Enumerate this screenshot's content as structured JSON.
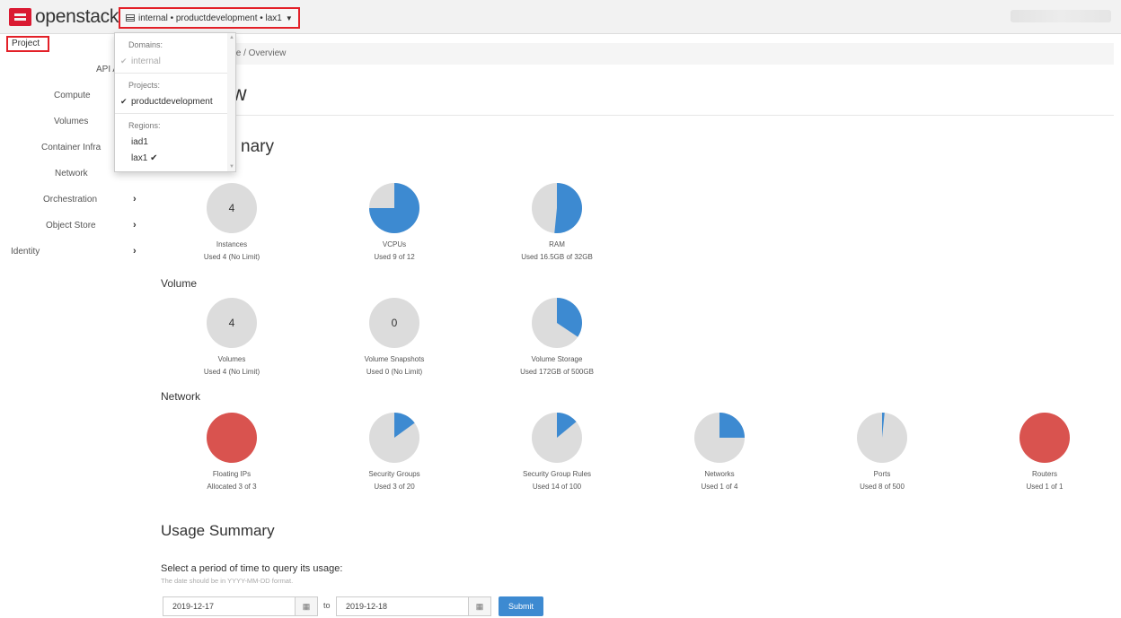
{
  "header": {
    "brand": "openstack",
    "brand_dot": ".",
    "context_label": "internal • productdevelopment • lax1"
  },
  "dropdown": {
    "domains_header": "Domains:",
    "domain_item": "internal",
    "projects_header": "Projects:",
    "project_item": "productdevelopment",
    "regions_header": "Regions:",
    "region_items": [
      "iad1",
      "lax1"
    ]
  },
  "sidebar": {
    "project_label": "Project",
    "api_access": "API A",
    "items": [
      {
        "label": "Compute"
      },
      {
        "label": "Volumes"
      },
      {
        "label": "Container Infra"
      },
      {
        "label": "Network"
      },
      {
        "label": "Orchestration"
      },
      {
        "label": "Object Store"
      },
      {
        "label": "Identity"
      }
    ]
  },
  "breadcrumb": "te / Overview",
  "page_title": "w",
  "section_title": "nary",
  "groups": {
    "volume": "Volume",
    "network": "Network"
  },
  "limits": {
    "compute": [
      {
        "title": "Instances",
        "sub": "Used 4 (No Limit)",
        "number": "4",
        "fraction": 0
      },
      {
        "title": "VCPUs",
        "sub": "Used 9 of 12",
        "fraction": 0.75
      },
      {
        "title": "RAM",
        "sub": "Used 16.5GB of 32GB",
        "fraction": 0.5156
      }
    ],
    "volume": [
      {
        "title": "Volumes",
        "sub": "Used 4 (No Limit)",
        "number": "4",
        "fraction": 0
      },
      {
        "title": "Volume Snapshots",
        "sub": "Used 0 (No Limit)",
        "number": "0",
        "fraction": 0
      },
      {
        "title": "Volume Storage",
        "sub": "Used 172GB of 500GB",
        "fraction": 0.344
      }
    ],
    "network": [
      {
        "title": "Floating IPs",
        "sub": "Allocated 3 of 3",
        "fraction": 1
      },
      {
        "title": "Security Groups",
        "sub": "Used 3 of 20",
        "fraction": 0.15
      },
      {
        "title": "Security Group Rules",
        "sub": "Used 14 of 100",
        "fraction": 0.14
      },
      {
        "title": "Networks",
        "sub": "Used 1 of 4",
        "fraction": 0.25
      },
      {
        "title": "Ports",
        "sub": "Used 8 of 500",
        "fraction": 0.016
      },
      {
        "title": "Routers",
        "sub": "Used 1 of 1",
        "fraction": 1
      }
    ]
  },
  "colors": {
    "used_partial": "#3d8ad1",
    "used_full": "#d9534f",
    "unused": "#dcdcdc",
    "accent": "#e32028"
  },
  "usage": {
    "title": "Usage Summary",
    "label": "Select a period of time to query its usage:",
    "help": "The date should be in YYYY-MM-DD format.",
    "start": "2019-12-17",
    "to": "to",
    "end": "2019-12-18",
    "submit": "Submit"
  }
}
